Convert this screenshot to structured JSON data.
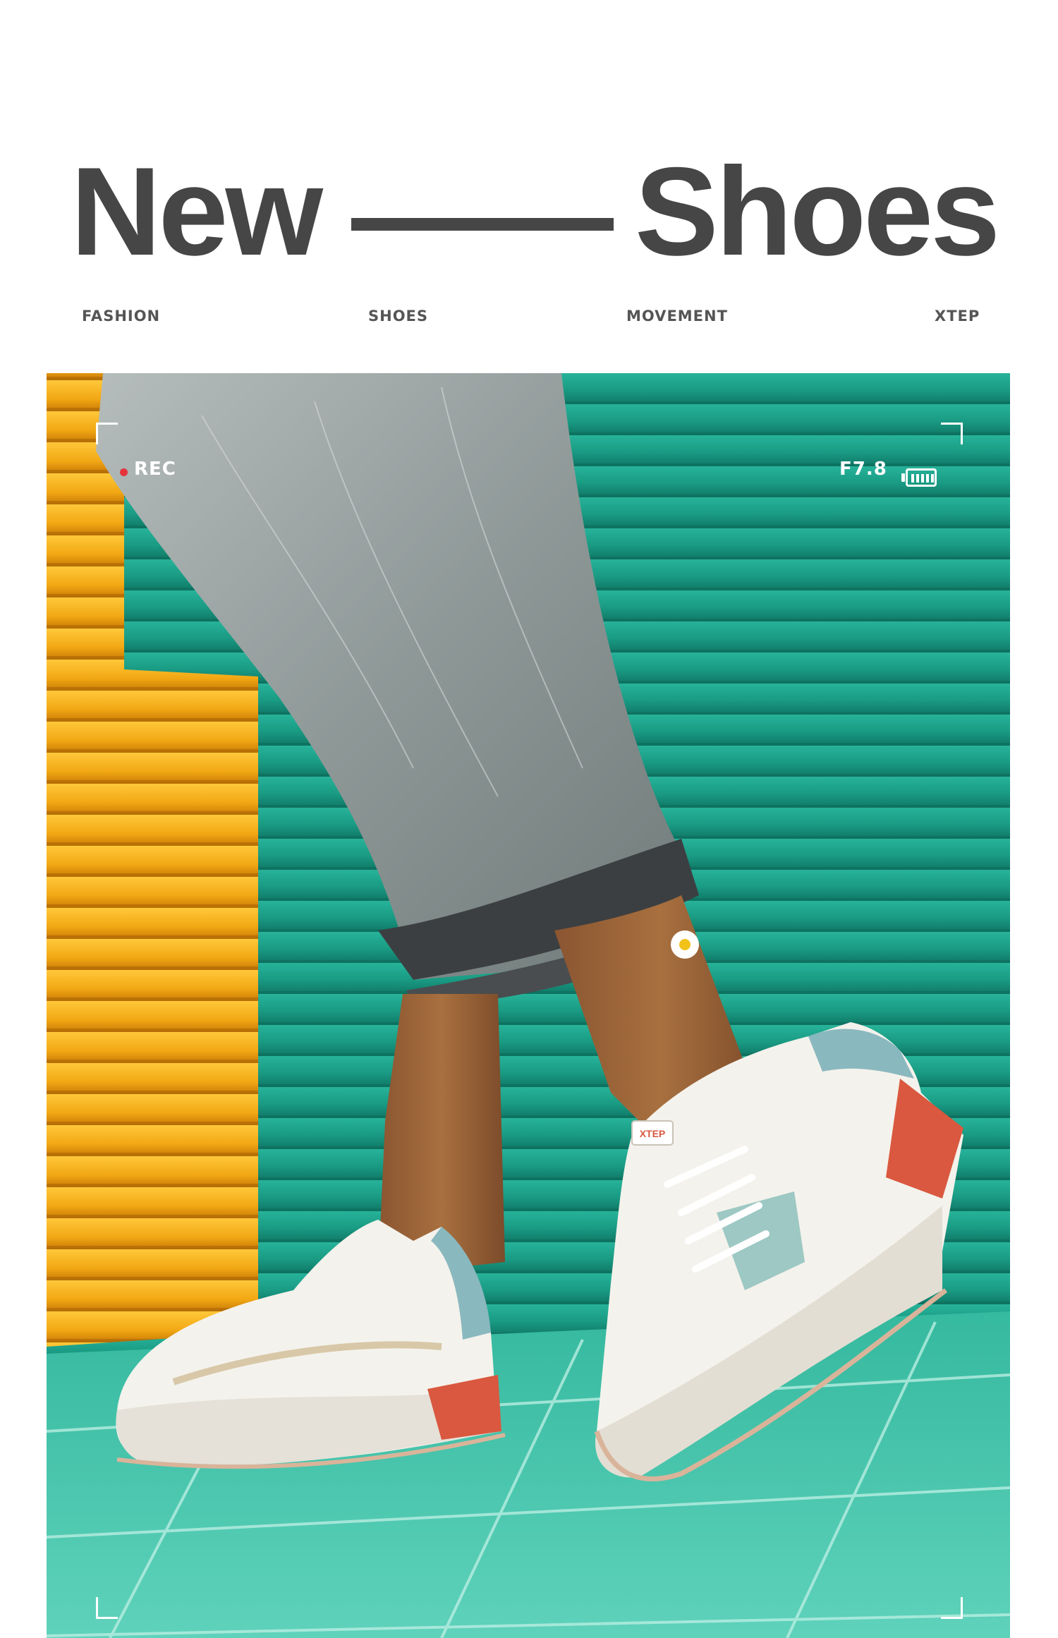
{
  "headline": {
    "left_word": "New",
    "right_word": "Shoes"
  },
  "tags": [
    "FASHION",
    "SHOES",
    "MOVEMENT",
    "XTEP"
  ],
  "camera_overlay": {
    "rec_label": "REC",
    "aperture": "F7.8",
    "battery_level": 1.0,
    "rec_dot_color": "#e5333c"
  },
  "colors": {
    "headline": "#464646",
    "wall_teal": "#1fa48d",
    "wall_yellow": "#f2ad18",
    "floor": "#3ec4aa",
    "sole_accent": "#d9583f"
  },
  "shoe_logo": "XTEP"
}
